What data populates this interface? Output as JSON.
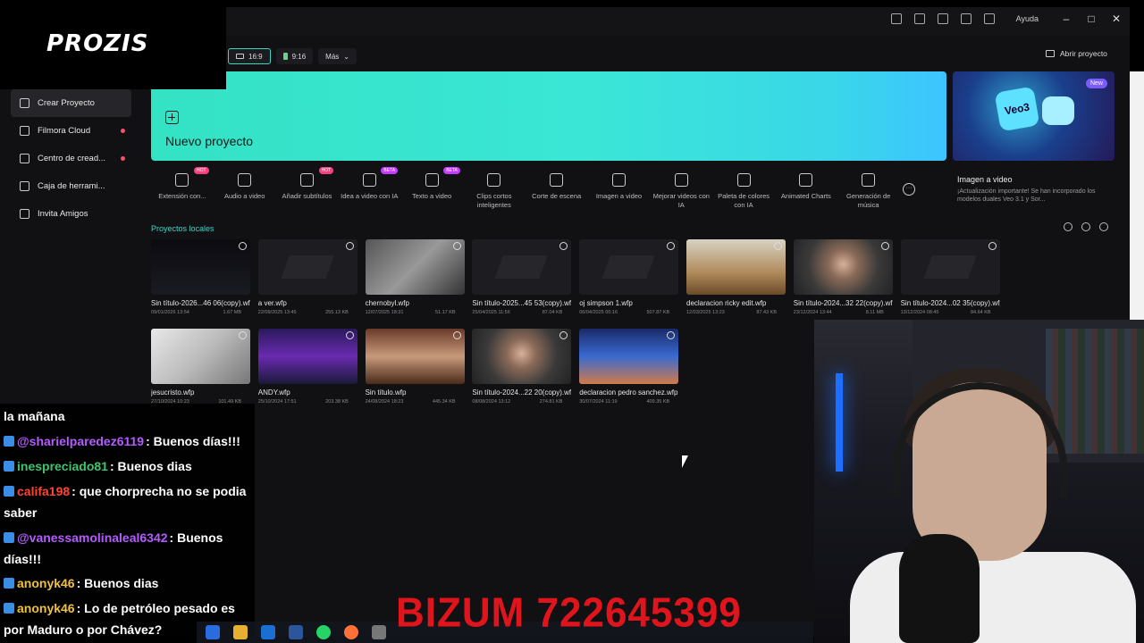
{
  "topbar": {
    "help": "Ayuda"
  },
  "sidebar": {
    "items": [
      {
        "label": "Crear Proyecto",
        "active": true,
        "dot": false
      },
      {
        "label": "Filmora Cloud",
        "active": false,
        "dot": true
      },
      {
        "label": "Centro de cread...",
        "active": false,
        "dot": true
      },
      {
        "label": "Caja de herrami...",
        "active": false,
        "dot": false
      },
      {
        "label": "Invita Amigos",
        "active": false,
        "dot": false
      }
    ]
  },
  "ratios": {
    "r1": "16:9",
    "r2": "9:16",
    "more": "Más"
  },
  "open_project": "Abrir proyecto",
  "new_project": {
    "label": "Nuevo proyecto"
  },
  "promo": {
    "badge": "New",
    "brand": "Veo3",
    "title": "Imagen a video",
    "desc": "¡Actualización importante! Se han incorporado los modelos duales Veo 3.1 y Sor..."
  },
  "tools": [
    {
      "label": "Extensión con...",
      "badge": "HOT"
    },
    {
      "label": "Audio a video",
      "badge": ""
    },
    {
      "label": "Añadir subtítulos",
      "badge": "HOT"
    },
    {
      "label": "Idea a video con IA",
      "badge": "BETA"
    },
    {
      "label": "Texto a video",
      "badge": "BETA"
    },
    {
      "label": "Clips cortos inteligentes",
      "badge": ""
    },
    {
      "label": "Corte de escena",
      "badge": ""
    },
    {
      "label": "Imagen a video",
      "badge": ""
    },
    {
      "label": "Mejorar videos con IA",
      "badge": ""
    },
    {
      "label": "Paleta de colores con IA",
      "badge": ""
    },
    {
      "label": "Animated Charts",
      "badge": ""
    },
    {
      "label": "Generación de música",
      "badge": ""
    }
  ],
  "local": {
    "title": "Proyectos locales"
  },
  "projects": [
    {
      "name": "Sin título-2026...46 06(copy).wfp",
      "date": "09/01/2026 13:54",
      "size": "1.67 MB",
      "thumb": "title"
    },
    {
      "name": "a ver.wfp",
      "date": "22/09/2025 13:45",
      "size": "255.13 KB",
      "thumb": "empty"
    },
    {
      "name": "chernobyl.wfp",
      "date": "12/07/2025 18:31",
      "size": "51.17 KB",
      "thumb": "gray"
    },
    {
      "name": "Sin título-2025...45 53(copy).wfp",
      "date": "25/04/2025 11:56",
      "size": "87.04 KB",
      "thumb": "empty"
    },
    {
      "name": "oj simpson 1.wfp",
      "date": "06/04/2025 00:16",
      "size": "507.87 KB",
      "thumb": "empty"
    },
    {
      "name": "declaracion ricky edit.wfp",
      "date": "12/03/2025 13:23",
      "size": "87.43 KB",
      "thumb": "room"
    },
    {
      "name": "Sin título-2024...32 22(copy).wfp",
      "date": "23/12/2024 13:44",
      "size": "8.11 MB",
      "thumb": "person"
    },
    {
      "name": "Sin título-2024...02 35(copy).wfp",
      "date": "13/12/2024 08:45",
      "size": "84.64 KB",
      "thumb": "empty"
    },
    {
      "name": "jesucristo.wfp",
      "date": "27/10/2024 10:23",
      "size": "101.49 KB",
      "thumb": "white"
    },
    {
      "name": "ANDY.wfp",
      "date": "25/10/2024 17:51",
      "size": "203.38 KB",
      "thumb": "purple"
    },
    {
      "name": "Sin título.wfp",
      "date": "24/08/2024 18:23",
      "size": "445.34 KB",
      "thumb": "brown"
    },
    {
      "name": "Sin título-2024...22 20(copy).wfp",
      "date": "08/08/2024 13:12",
      "size": "274.81 KB",
      "thumb": "person"
    },
    {
      "name": "declaracion pedro sanchez.wfp",
      "date": "30/07/2024 11:19",
      "size": "409.35 KB",
      "thumb": "blue"
    }
  ],
  "logo": "PROZIS",
  "chat": [
    {
      "user": "",
      "text": "la mañana",
      "color": "#ffffff"
    },
    {
      "user": "@sharielparedez6119",
      "text": ": Buenos días!!!",
      "color": "#b45cff"
    },
    {
      "user": "inespreciado81",
      "text": ": Buenos dias",
      "color": "#3ec46d"
    },
    {
      "user": "califa198",
      "text": ": que chorprecha no se podia saber",
      "color": "#ff4433"
    },
    {
      "user": "@vanessamolinaleal6342",
      "text": ": Buenos días!!!",
      "color": "#b45cff"
    },
    {
      "user": "anonyk46",
      "text": ": Buenos dias",
      "color": "#f0c040"
    },
    {
      "user": "anonyk46",
      "text": ": Lo de petróleo pesado es por Maduro o por Chávez?",
      "color": "#f0c040"
    }
  ],
  "bizum": "BIZUM 722645399",
  "colors": {
    "accent": "#3bd6c4",
    "chat_bg": "#000000",
    "bizum": "#e0141c"
  }
}
